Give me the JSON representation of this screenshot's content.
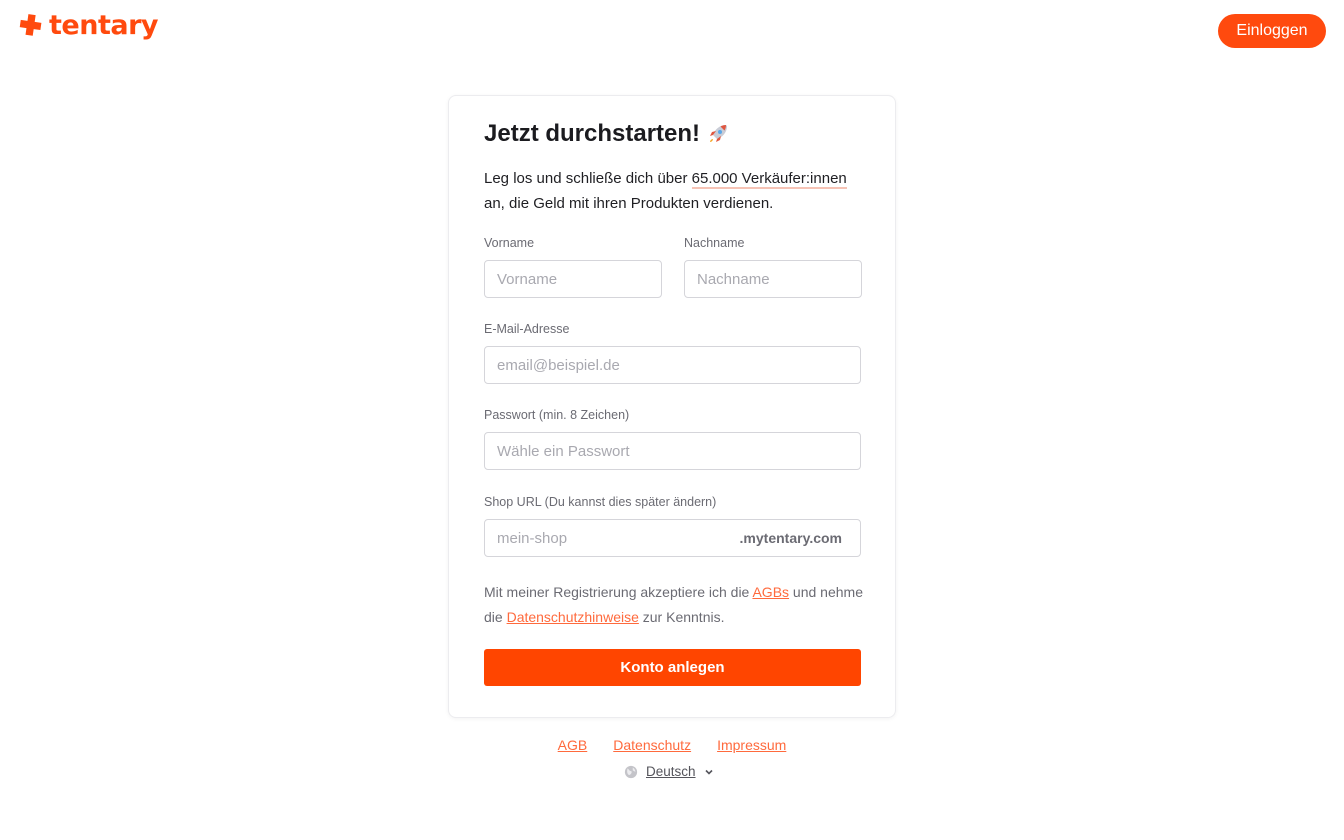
{
  "brand": {
    "name": "tentary",
    "color": "#ff4a0e"
  },
  "header": {
    "login_label": "Einloggen"
  },
  "signup": {
    "title": "Jetzt durchstarten!",
    "title_icon": "rocket-icon",
    "subtitle_part1": "Leg los und schließe dich über ",
    "subtitle_highlight": "65.000 Verkäufer:innen",
    "subtitle_part2": " an, die Geld mit ihren Produkten verdienen.",
    "first_name": {
      "label": "Vorname",
      "placeholder": "Vorname",
      "value": ""
    },
    "last_name": {
      "label": "Nachname",
      "placeholder": "Nachname",
      "value": ""
    },
    "email": {
      "label": "E-Mail-Adresse",
      "placeholder": "email@beispiel.de",
      "value": ""
    },
    "password": {
      "label": "Passwort (min. 8 Zeichen)",
      "placeholder": "Wähle ein Passwort",
      "value": ""
    },
    "shop_url": {
      "label": "Shop URL (Du kannst dies später ändern)",
      "placeholder": "mein-shop",
      "suffix": ".mytentary.com",
      "value": ""
    },
    "terms": {
      "part1": "Mit meiner Registrierung akzeptiere ich die ",
      "agb_link": "AGBs",
      "part2": " und nehme die ",
      "privacy_link": "Datenschutzhinweise",
      "part3": " zur Kenntnis."
    },
    "submit_label": "Konto anlegen"
  },
  "footer": {
    "links": {
      "agb": "AGB",
      "privacy": "Datenschutz",
      "imprint": "Impressum"
    },
    "language": {
      "icon": "globe-icon",
      "selected": "Deutsch",
      "dropdown_icon": "chevron-down-icon"
    }
  },
  "colors": {
    "accent": "#ff4500",
    "link": "#ff6a3d",
    "text_muted": "#6b6b73"
  }
}
